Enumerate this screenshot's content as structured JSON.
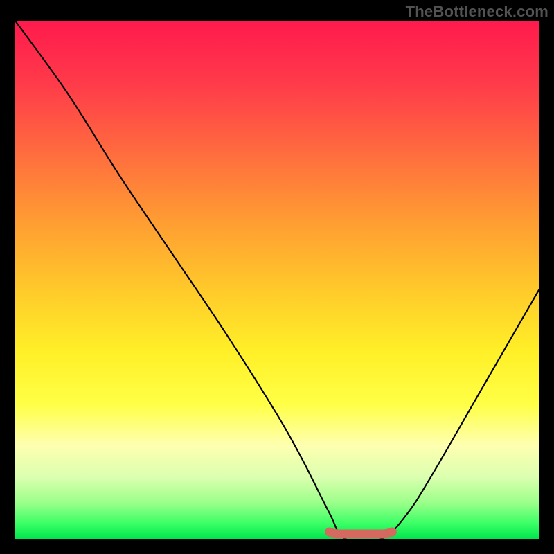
{
  "watermark": "TheBottleneck.com",
  "chart_data": {
    "type": "line",
    "title": "",
    "xlabel": "",
    "ylabel": "",
    "xlim": [
      0,
      100
    ],
    "ylim": [
      0,
      100
    ],
    "background_gradient_meaning": "red (top) = high bottleneck, green (bottom) = no bottleneck",
    "series": [
      {
        "name": "bottleneck-curve",
        "x": [
          0,
          10,
          20,
          30,
          40,
          50,
          55,
          60,
          63,
          70,
          75,
          80,
          88,
          100
        ],
        "values": [
          100,
          86,
          70,
          55,
          40,
          24,
          15,
          5,
          0,
          0,
          5,
          13,
          27,
          48
        ]
      }
    ],
    "optimal_band": {
      "x_start": 60,
      "x_end": 72,
      "value": 0
    },
    "grid": false,
    "legend": false
  }
}
